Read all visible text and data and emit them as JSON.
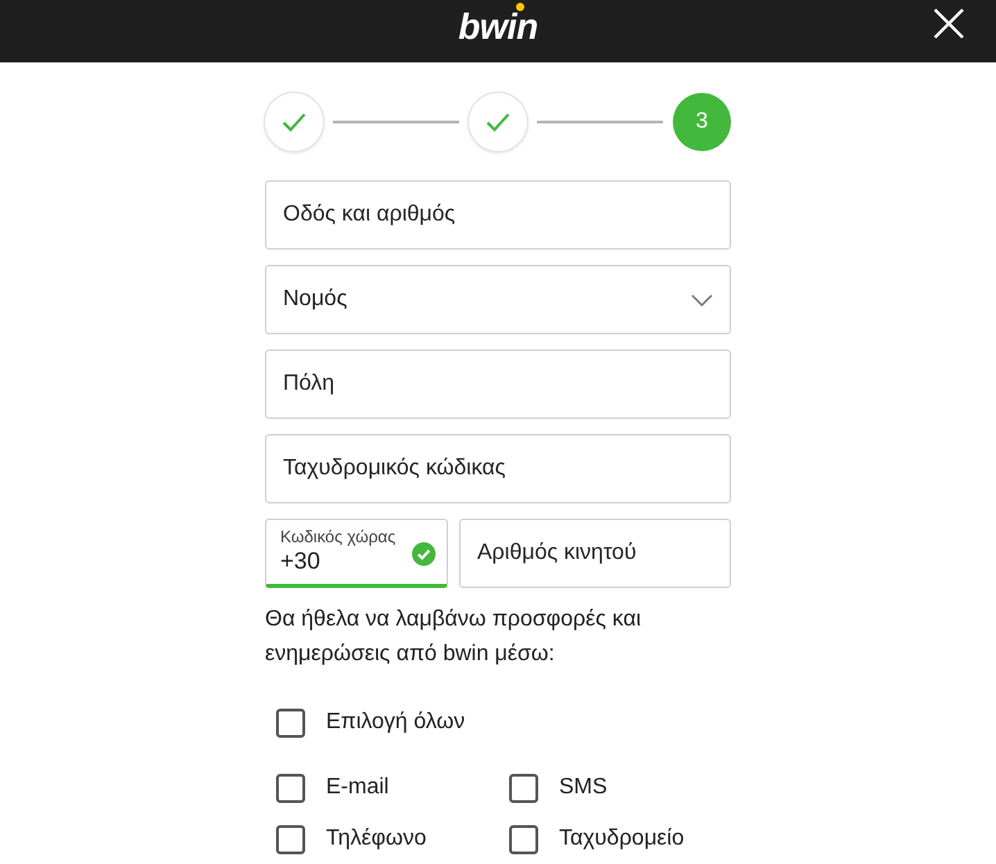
{
  "header": {
    "logo": "bwin"
  },
  "steps": [
    {
      "completed": true,
      "selected": false
    },
    {
      "completed": true,
      "selected": false
    },
    {
      "completed": false,
      "selected": true,
      "label": "3"
    }
  ],
  "fields": [
    {
      "kind": "text",
      "placeholder": "Οδός και αριθμός"
    },
    {
      "kind": "select",
      "placeholder": "Νομός"
    },
    {
      "kind": "text",
      "placeholder": "Πόλη"
    },
    {
      "kind": "text",
      "placeholder": "Ταχυδρομικός κώδικας"
    }
  ],
  "phone": {
    "country_code": {
      "label": "Κωδικός χώρας",
      "value": "+30",
      "valid": true
    },
    "number": {
      "placeholder": "Αριθμός κινητού"
    }
  },
  "consent": {
    "text": "Θα ήθελα να λαμβάνω προσφορές και ενημερώσεις από bwin μέσω:",
    "select_all": {
      "label": "Επιλογή όλων",
      "checked": false
    },
    "channels": [
      {
        "label": "E-mail",
        "checked": false
      },
      {
        "label": "SMS",
        "checked": false
      },
      {
        "label": "Τηλέφωνο",
        "checked": false
      },
      {
        "label": "Ταχυδρομείο",
        "checked": false
      }
    ]
  }
}
